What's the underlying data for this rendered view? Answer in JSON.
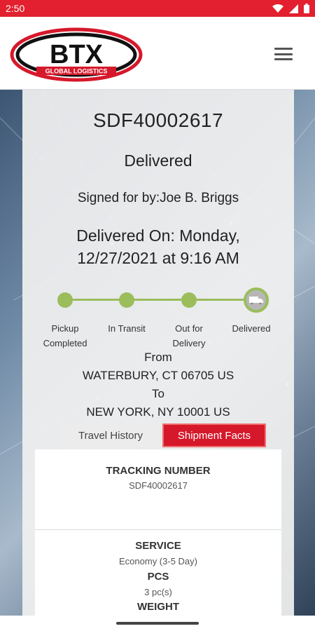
{
  "status_bar": {
    "time": "2:50"
  },
  "header": {
    "logo_text": "BTX",
    "logo_subtext": "GLOBAL LOGISTICS"
  },
  "shipment": {
    "tracking_number": "SDF40002617",
    "status": "Delivered",
    "signed_for": "Signed for by:Joe B. Briggs",
    "delivered_on_line1": "Delivered On: Monday,",
    "delivered_on_line2": "12/27/2021 at 9:16 AM"
  },
  "progress": {
    "steps": [
      {
        "line1": "Pickup",
        "line2": "Completed"
      },
      {
        "line1": "In Transit",
        "line2": ""
      },
      {
        "line1": "Out for",
        "line2": "Delivery"
      },
      {
        "line1": "Delivered",
        "line2": ""
      }
    ],
    "current_step": 4
  },
  "route": {
    "from_label": "From",
    "from": "WATERBURY, CT 06705 US",
    "to_label": "To",
    "to": "NEW YORK, NY 10001 US"
  },
  "tabs": {
    "travel_history": "Travel History",
    "shipment_facts": "Shipment Facts",
    "active": "shipment_facts"
  },
  "facts": {
    "tracking_number_label": "TRACKING NUMBER",
    "tracking_number_value": "SDF40002617",
    "service_label": "SERVICE",
    "service_value": "Economy (3-5 Day)",
    "pcs_label": "PCS",
    "pcs_value": "3 pc(s)",
    "weight_label": "WEIGHT"
  },
  "colors": {
    "brand_red": "#e2202f",
    "progress_green": "#9bbd5c"
  }
}
